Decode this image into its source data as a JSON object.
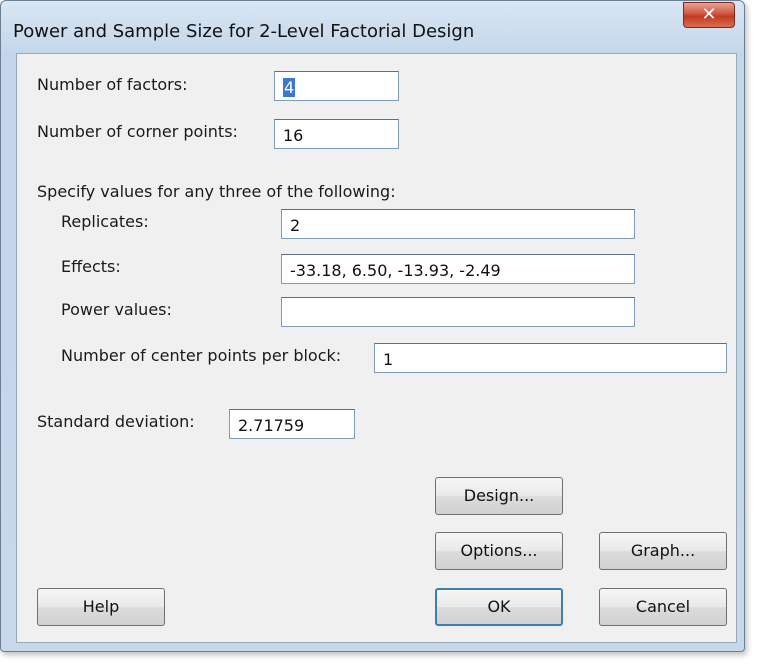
{
  "window": {
    "title": "Power and Sample Size for 2-Level Factorial Design",
    "close_symbol": "✕"
  },
  "form": {
    "num_factors": {
      "label": "Number of factors:",
      "value": "4"
    },
    "num_corner_points": {
      "label": "Number of corner points:",
      "value": "16"
    },
    "specify_label": "Specify values for any three of the following:",
    "replicates": {
      "label": "Replicates:",
      "value": "2"
    },
    "effects": {
      "label": "Effects:",
      "value": "-33.18, 6.50, -13.93, -2.49"
    },
    "power_values": {
      "label": "Power values:",
      "value": ""
    },
    "center_points": {
      "label": "Number of center points per block:",
      "value": "1"
    },
    "std_dev": {
      "label": "Standard deviation:",
      "value": "2.71759"
    }
  },
  "buttons": {
    "design": "Design...",
    "options": "Options...",
    "graph": "Graph...",
    "help": "Help",
    "ok": "OK",
    "cancel": "Cancel"
  }
}
